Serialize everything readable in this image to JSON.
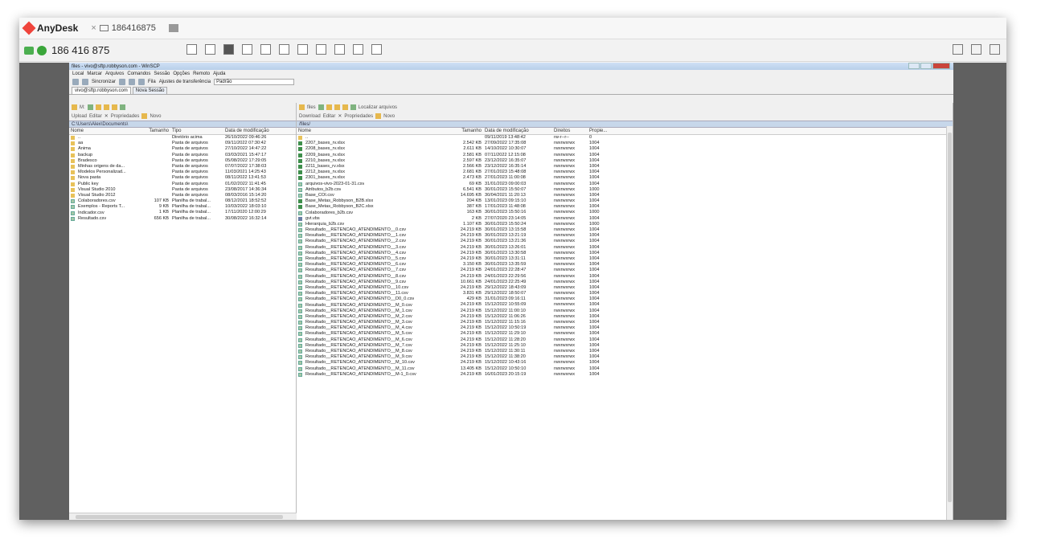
{
  "anydesk": {
    "brand": "AnyDesk",
    "tab_id": "186416875",
    "address": "186 416 875"
  },
  "winscp": {
    "title": "files - vivo@sftp.robbyson.com - WinSCP",
    "menu": [
      "Local",
      "Marcar",
      "Arquivos",
      "Comandos",
      "Sessão",
      "Opções",
      "Remoto",
      "Ajuda"
    ],
    "toolbar": {
      "sync": "Sincronizar",
      "fila": "Fila",
      "transfer_settings": "Ajustes de transferência",
      "transfer_preset": "Padrão"
    },
    "tabs": {
      "session": "vivo@sftp.robbyson.com",
      "new_session": "Nova Sessão"
    }
  },
  "local_pane": {
    "drive": "M:",
    "upload": "Upload",
    "edit": "Editar",
    "properties": "Propriedades",
    "new": "Novo",
    "path": "C:\\Users\\Alex\\Documents\\",
    "headers": {
      "name": "Nome",
      "size": "Tamanho",
      "type": "Tipo",
      "date": "Data de modificação"
    },
    "rows": [
      {
        "icon": "up",
        "name": "..",
        "size": "",
        "type": "Diretório acima",
        "date": "26/10/2022 09:46:26"
      },
      {
        "icon": "folder",
        "name": "aa",
        "size": "",
        "type": "Pasta de arquivos",
        "date": "09/11/2022 07:30:42"
      },
      {
        "icon": "folder",
        "name": "Anima",
        "size": "",
        "type": "Pasta de arquivos",
        "date": "27/10/2022 14:47:22"
      },
      {
        "icon": "folder",
        "name": "backup",
        "size": "",
        "type": "Pasta de arquivos",
        "date": "03/03/2021 15:47:17"
      },
      {
        "icon": "folder",
        "name": "Bradesco",
        "size": "",
        "type": "Pasta de arquivos",
        "date": "05/08/2022 17:29:05"
      },
      {
        "icon": "folder",
        "name": "Minhas origens de da...",
        "size": "",
        "type": "Pasta de arquivos",
        "date": "07/07/2022 17:38:03"
      },
      {
        "icon": "folder",
        "name": "Modelos Personalizad...",
        "size": "",
        "type": "Pasta de arquivos",
        "date": "11/03/2021 14:25:43"
      },
      {
        "icon": "folder",
        "name": "Nova pasta",
        "size": "",
        "type": "Pasta de arquivos",
        "date": "08/11/2022 13:41:53"
      },
      {
        "icon": "folder",
        "name": "Public key",
        "size": "",
        "type": "Pasta de arquivos",
        "date": "01/02/2022 11:41:45"
      },
      {
        "icon": "folder",
        "name": "Visual Studio 2010",
        "size": "",
        "type": "Pasta de arquivos",
        "date": "23/08/2017 14:36:34"
      },
      {
        "icon": "folder",
        "name": "Visual Studio 2012",
        "size": "",
        "type": "Pasta de arquivos",
        "date": "08/03/2016 15:14:20"
      },
      {
        "icon": "csv",
        "name": "Colaboradores.csv",
        "size": "107 KB",
        "type": "Planilha de trabal...",
        "date": "08/12/2021 18:52:52"
      },
      {
        "icon": "csv",
        "name": "Exemplos - Reports T...",
        "size": "9 KB",
        "type": "Planilha de trabal...",
        "date": "10/03/2022 18:03:10"
      },
      {
        "icon": "csv",
        "name": "Indicador.csv",
        "size": "1 KB",
        "type": "Planilha de trabal...",
        "date": "17/11/2020 12:00:29"
      },
      {
        "icon": "csv",
        "name": "Resultado.csv",
        "size": "656 KB",
        "type": "Planilha de trabal...",
        "date": "30/08/2022 16:32:14"
      }
    ]
  },
  "remote_pane": {
    "folder": "files",
    "download": "Download",
    "edit": "Editar",
    "properties": "Propriedades",
    "new": "Novo",
    "find": "Localizar arquivos",
    "path": "/files/",
    "headers": {
      "name": "Nome",
      "size": "Tamanho",
      "date": "Data de modificação",
      "rights": "Direitos",
      "owner": "Propie..."
    },
    "rows": [
      {
        "icon": "up",
        "name": "..",
        "size": "",
        "date": "09/11/2019 13:48:42",
        "rights": "rw-r--r--",
        "owner": "0"
      },
      {
        "icon": "xls",
        "name": "2207_bases_rv.xlsx",
        "size": "2.542 KB",
        "date": "27/09/2022 17:35:08",
        "rights": "rwxrwxrwx",
        "owner": "1004"
      },
      {
        "icon": "xls",
        "name": "2208_bases_rv.xlsx",
        "size": "2.611 KB",
        "date": "14/10/2022 10:30:07",
        "rights": "rwxrwxrwx",
        "owner": "1004"
      },
      {
        "icon": "xls",
        "name": "2209_bases_rv.xlsx",
        "size": "2.581 KB",
        "date": "07/11/2022 12:15:08",
        "rights": "rwxrwxrwx",
        "owner": "1004"
      },
      {
        "icon": "xls",
        "name": "2210_bases_rv.xlsx",
        "size": "2.597 KB",
        "date": "23/12/2022 16:35:07",
        "rights": "rwxrwxrwx",
        "owner": "1004"
      },
      {
        "icon": "xls",
        "name": "2211_bases_rv.xlsx",
        "size": "2.566 KB",
        "date": "23/12/2022 16:35:14",
        "rights": "rwxrwxrwx",
        "owner": "1004"
      },
      {
        "icon": "xls",
        "name": "2212_bases_rv.xlsx",
        "size": "2.681 KB",
        "date": "27/01/2023 15:48:08",
        "rights": "rwxrwxrwx",
        "owner": "1004"
      },
      {
        "icon": "xls",
        "name": "2301_bases_rv.xlsx",
        "size": "2.473 KB",
        "date": "27/01/2023 11:00:08",
        "rights": "rwxrwxrwx",
        "owner": "1004"
      },
      {
        "icon": "csv",
        "name": "arquivos-vivo-2023-01-31.csv",
        "size": "69 KB",
        "date": "31/01/2023 09:00:03",
        "rights": "rwxrwxrwx",
        "owner": "1004"
      },
      {
        "icon": "csv",
        "name": "Atributos_b2b.csv",
        "size": "6.541 KB",
        "date": "30/01/2023 15:50:07",
        "rights": "rwxrwxrwx",
        "owner": "1000"
      },
      {
        "icon": "csv",
        "name": "Base_COI.csv",
        "size": "14.695 KB",
        "date": "30/04/2021 11:20:13",
        "rights": "rwxrwxrwx",
        "owner": "1004"
      },
      {
        "icon": "xls",
        "name": "Base_Metas_Robbyson_B2B.xlsx",
        "size": "204 KB",
        "date": "13/01/2023 09:15:10",
        "rights": "rwxrwxrwx",
        "owner": "1004"
      },
      {
        "icon": "xls",
        "name": "Base_Metas_Robbyson_B2C.xlsx",
        "size": "387 KB",
        "date": "17/01/2023 11:48:08",
        "rights": "rwxrwxrwx",
        "owner": "1004"
      },
      {
        "icon": "csv",
        "name": "Colaboradores_b2b.csv",
        "size": "163 KB",
        "date": "30/01/2023 15:50:16",
        "rights": "rwxrwxrwx",
        "owner": "1000"
      },
      {
        "icon": "vbs",
        "name": "gvt.vbs",
        "size": "2 KB",
        "date": "27/07/2020 23:14:05",
        "rights": "rwxrwxrwx",
        "owner": "1004"
      },
      {
        "icon": "csv",
        "name": "Hierarquia_b2b.csv",
        "size": "1.107 KB",
        "date": "30/01/2023 15:50:24",
        "rights": "rwxrwxrwx",
        "owner": "1000"
      },
      {
        "icon": "csv",
        "name": "Resultado__RETENCAO_ATENDIMENTO__0.csv",
        "size": "24.219 KB",
        "date": "30/01/2023 13:15:58",
        "rights": "rwxrwxrwx",
        "owner": "1004"
      },
      {
        "icon": "csv",
        "name": "Resultado__RETENCAO_ATENDIMENTO__1.csv",
        "size": "24.219 KB",
        "date": "30/01/2023 13:21:19",
        "rights": "rwxrwxrwx",
        "owner": "1004"
      },
      {
        "icon": "csv",
        "name": "Resultado__RETENCAO_ATENDIMENTO__2.csv",
        "size": "24.219 KB",
        "date": "30/01/2023 13:21:36",
        "rights": "rwxrwxrwx",
        "owner": "1004"
      },
      {
        "icon": "csv",
        "name": "Resultado__RETENCAO_ATENDIMENTO__3.csv",
        "size": "24.219 KB",
        "date": "30/01/2023 13:26:01",
        "rights": "rwxrwxrwx",
        "owner": "1004"
      },
      {
        "icon": "csv",
        "name": "Resultado__RETENCAO_ATENDIMENTO__4.csv",
        "size": "24.219 KB",
        "date": "30/01/2023 13:30:58",
        "rights": "rwxrwxrwx",
        "owner": "1004"
      },
      {
        "icon": "csv",
        "name": "Resultado__RETENCAO_ATENDIMENTO__5.csv",
        "size": "24.219 KB",
        "date": "30/01/2023 13:31:11",
        "rights": "rwxrwxrwx",
        "owner": "1004"
      },
      {
        "icon": "csv",
        "name": "Resultado__RETENCAO_ATENDIMENTO__6.csv",
        "size": "3.150 KB",
        "date": "30/01/2023 13:35:59",
        "rights": "rwxrwxrwx",
        "owner": "1004"
      },
      {
        "icon": "csv",
        "name": "Resultado__RETENCAO_ATENDIMENTO__7.csv",
        "size": "24.219 KB",
        "date": "24/01/2023 22:28:47",
        "rights": "rwxrwxrwx",
        "owner": "1004"
      },
      {
        "icon": "csv",
        "name": "Resultado__RETENCAO_ATENDIMENTO__8.csv",
        "size": "24.219 KB",
        "date": "24/01/2023 22:29:56",
        "rights": "rwxrwxrwx",
        "owner": "1004"
      },
      {
        "icon": "csv",
        "name": "Resultado__RETENCAO_ATENDIMENTO__9.csv",
        "size": "10.661 KB",
        "date": "24/01/2023 22:25:49",
        "rights": "rwxrwxrwx",
        "owner": "1004"
      },
      {
        "icon": "csv",
        "name": "Resultado__RETENCAO_ATENDIMENTO__10.csv",
        "size": "24.219 KB",
        "date": "29/12/2022 18:43:09",
        "rights": "rwxrwxrwx",
        "owner": "1004"
      },
      {
        "icon": "csv",
        "name": "Resultado__RETENCAO_ATENDIMENTO__11.csv",
        "size": "3.831 KB",
        "date": "29/12/2022 18:50:07",
        "rights": "rwxrwxrwx",
        "owner": "1004"
      },
      {
        "icon": "csv",
        "name": "Resultado__RETENCAO_ATENDIMENTO__D0_0.csv",
        "size": "429 KB",
        "date": "31/01/2023 09:16:11",
        "rights": "rwxrwxrwx",
        "owner": "1004"
      },
      {
        "icon": "csv",
        "name": "Resultado__RETENCAO_ATENDIMENTO__M_0.csv",
        "size": "24.219 KB",
        "date": "15/12/2022 10:55:09",
        "rights": "rwxrwxrwx",
        "owner": "1004"
      },
      {
        "icon": "csv",
        "name": "Resultado__RETENCAO_ATENDIMENTO__M_1.csv",
        "size": "24.219 KB",
        "date": "15/12/2022 11:00:10",
        "rights": "rwxrwxrwx",
        "owner": "1004"
      },
      {
        "icon": "csv",
        "name": "Resultado__RETENCAO_ATENDIMENTO__M_2.csv",
        "size": "24.219 KB",
        "date": "15/12/2022 11:06:26",
        "rights": "rwxrwxrwx",
        "owner": "1004"
      },
      {
        "icon": "csv",
        "name": "Resultado__RETENCAO_ATENDIMENTO__M_3.csv",
        "size": "24.219 KB",
        "date": "15/12/2022 11:15:16",
        "rights": "rwxrwxrwx",
        "owner": "1004"
      },
      {
        "icon": "csv",
        "name": "Resultado__RETENCAO_ATENDIMENTO__M_4.csv",
        "size": "24.219 KB",
        "date": "15/12/2022 10:50:19",
        "rights": "rwxrwxrwx",
        "owner": "1004"
      },
      {
        "icon": "csv",
        "name": "Resultado__RETENCAO_ATENDIMENTO__M_5.csv",
        "size": "24.219 KB",
        "date": "15/12/2022 11:29:10",
        "rights": "rwxrwxrwx",
        "owner": "1004"
      },
      {
        "icon": "csv",
        "name": "Resultado__RETENCAO_ATENDIMENTO__M_6.csv",
        "size": "24.219 KB",
        "date": "15/12/2022 11:28:20",
        "rights": "rwxrwxrwx",
        "owner": "1004"
      },
      {
        "icon": "csv",
        "name": "Resultado__RETENCAO_ATENDIMENTO__M_7.csv",
        "size": "24.219 KB",
        "date": "15/12/2022 11:25:10",
        "rights": "rwxrwxrwx",
        "owner": "1004"
      },
      {
        "icon": "csv",
        "name": "Resultado__RETENCAO_ATENDIMENTO__M_8.csv",
        "size": "24.219 KB",
        "date": "15/12/2022 11:30:11",
        "rights": "rwxrwxrwx",
        "owner": "1004"
      },
      {
        "icon": "csv",
        "name": "Resultado__RETENCAO_ATENDIMENTO__M_9.csv",
        "size": "24.219 KB",
        "date": "15/12/2022 11:38:20",
        "rights": "rwxrwxrwx",
        "owner": "1004"
      },
      {
        "icon": "csv",
        "name": "Resultado__RETENCAO_ATENDIMENTO__M_10.csv",
        "size": "24.219 KB",
        "date": "15/12/2022 10:43:16",
        "rights": "rwxrwxrwx",
        "owner": "1004"
      },
      {
        "icon": "csv",
        "name": "Resultado__RETENCAO_ATENDIMENTO__M_11.csv",
        "size": "13.405 KB",
        "date": "15/12/2022 10:50:10",
        "rights": "rwxrwxrwx",
        "owner": "1004"
      },
      {
        "icon": "csv",
        "name": "Resultado__RETENCAO_ATENDIMENTO__M-1_0.csv",
        "size": "24.219 KB",
        "date": "16/01/2023 20:15:19",
        "rights": "rwxrwxrwx",
        "owner": "1004"
      }
    ]
  }
}
